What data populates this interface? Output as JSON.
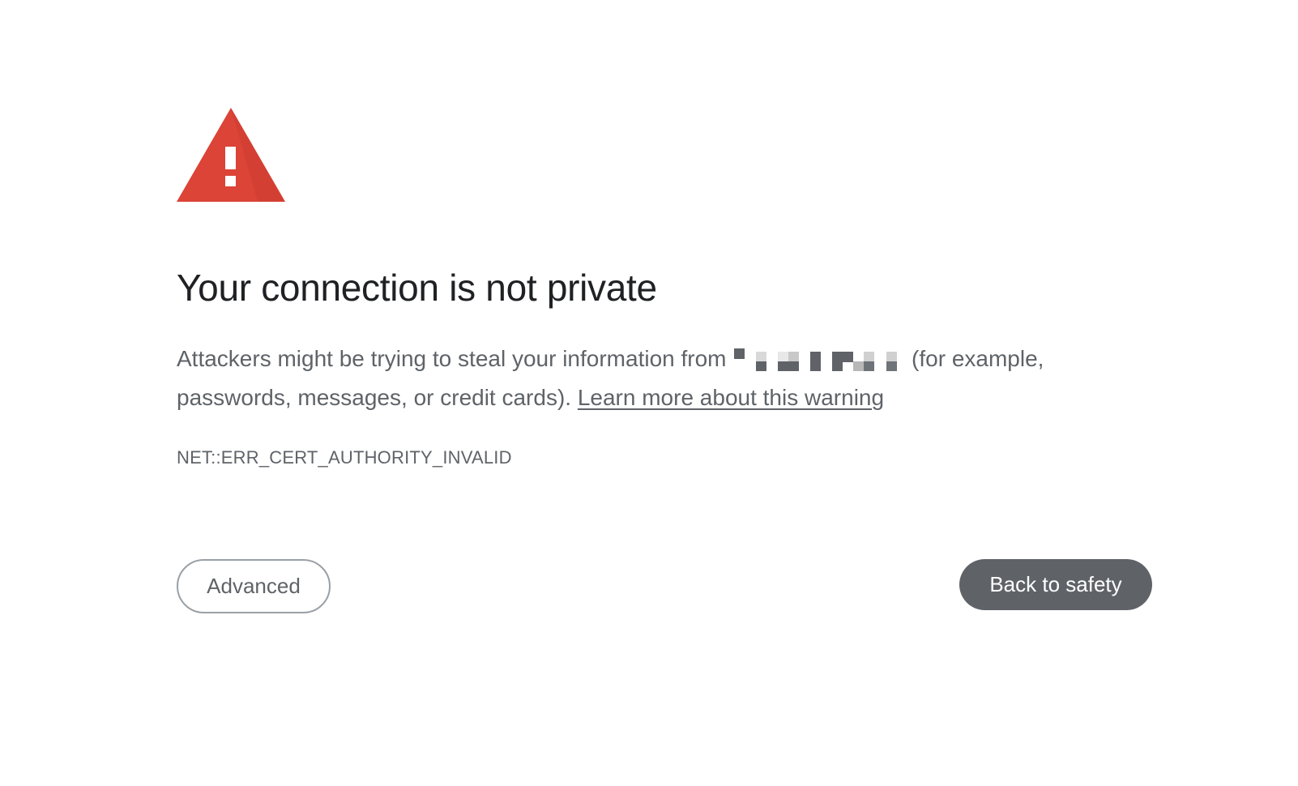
{
  "icon": {
    "name": "warning-triangle-icon",
    "color": "#db4437"
  },
  "title": "Your connection is not private",
  "message": {
    "before_domain": "Attackers might be trying to steal your information from ",
    "after_domain": " (for example, passwords, messages, or credit cards). ",
    "learn_more_label": "Learn more about this warning"
  },
  "error_code": "NET::ERR_CERT_AUTHORITY_INVALID",
  "buttons": {
    "advanced_label": "Advanced",
    "back_label": "Back to safety"
  },
  "colors": {
    "title_text": "#202124",
    "body_text": "#5f6368",
    "primary_button": "#5f6368",
    "secondary_border": "#9aa0a6"
  }
}
